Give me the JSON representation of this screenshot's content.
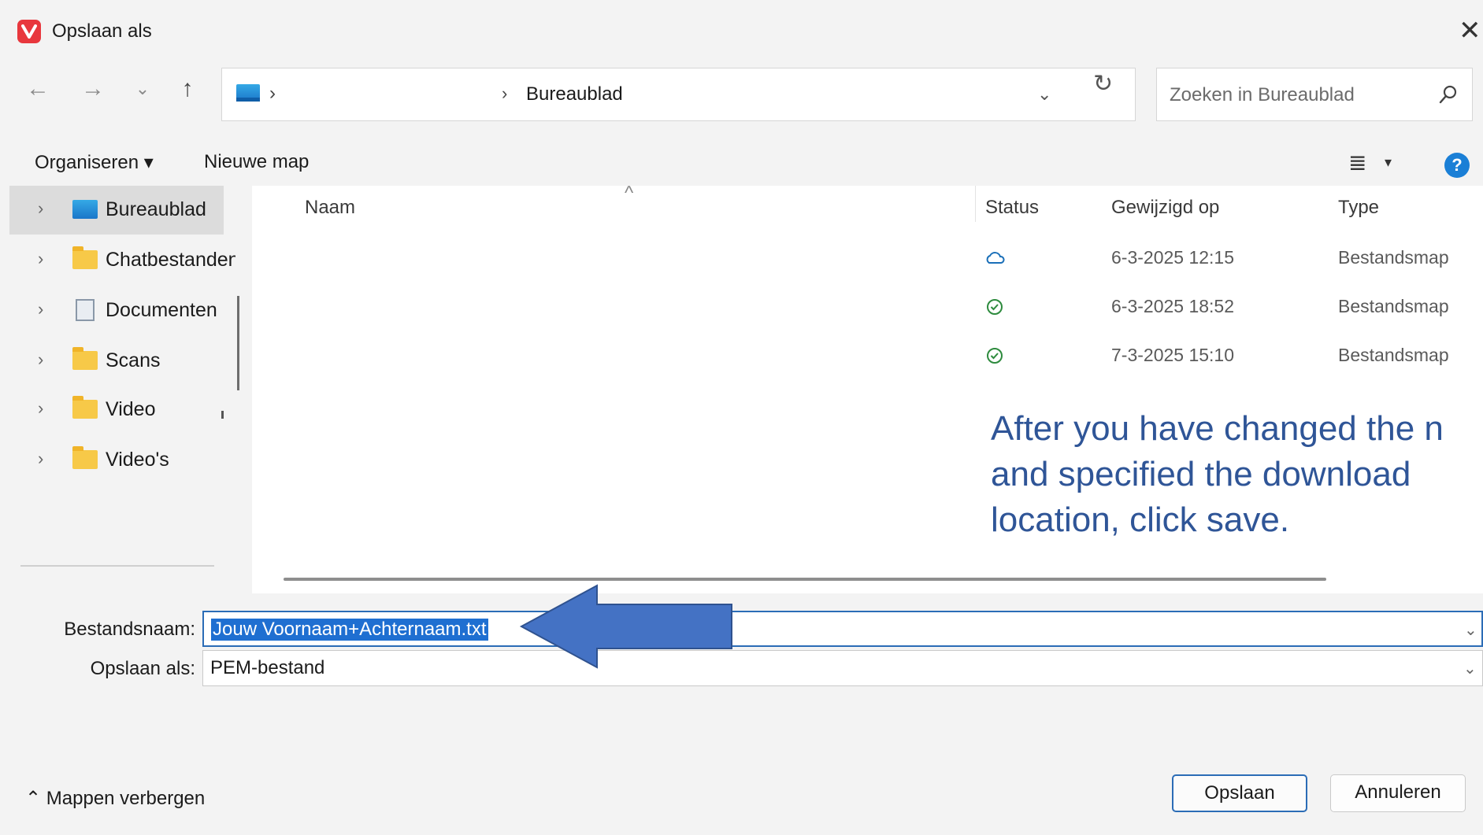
{
  "window": {
    "title": "Opslaan als",
    "close_glyph": "✕"
  },
  "nav": {
    "back": "←",
    "forward": "→",
    "recent": "⌄",
    "up": "↑",
    "breadcrumb_sep": "›",
    "breadcrumb": "Bureaublad",
    "dropdown": "⌄",
    "refresh": "↻",
    "search_placeholder": "Zoeken in Bureaublad"
  },
  "toolbar": {
    "organize": "Organiseren ▾",
    "new_folder": "Nieuwe map",
    "view_glyph": "≣",
    "view_caret": "▾",
    "help": "?"
  },
  "sidebar": {
    "items": [
      {
        "label": "Bureaublad",
        "icon": "desktop-icon"
      },
      {
        "label": "Chatbestanden",
        "icon": "folder-icon"
      },
      {
        "label": "Documenten",
        "icon": "documents-icon"
      },
      {
        "label": "Scans",
        "icon": "folder-icon"
      },
      {
        "label": "Video",
        "icon": "folder-icon"
      },
      {
        "label": "Video's",
        "icon": "folder-icon"
      }
    ],
    "chevron": "›"
  },
  "filelist": {
    "sort_caret": "^",
    "columns": {
      "name": "Naam",
      "status": "Status",
      "modified": "Gewijzigd op",
      "type": "Type"
    },
    "rows": [
      {
        "status": "cloud",
        "modified": "6-3-2025 12:15",
        "type": "Bestandsmap"
      },
      {
        "status": "synced",
        "modified": "6-3-2025 18:52",
        "type": "Bestandsmap"
      },
      {
        "status": "synced",
        "modified": "7-3-2025 15:10",
        "type": "Bestandsmap"
      }
    ]
  },
  "annotation": {
    "line1": "After you have changed the n",
    "line2": "and specified the download",
    "line3": "location, click save."
  },
  "form": {
    "filename_label": "Bestandsnaam:",
    "filename_value": "Jouw Voornaam+Achternaam.txt",
    "savetype_label": "Opslaan als:",
    "savetype_value": "PEM-bestand",
    "dropdown": "⌄"
  },
  "footer": {
    "hide_folders": "⌃  Mappen verbergen",
    "save": "Opslaan",
    "cancel": "Annuleren"
  },
  "colors": {
    "accent": "#2b6cb6",
    "annotation": "#2f5597",
    "arrow": "#4472c4",
    "selection": "#1f6fd1"
  }
}
